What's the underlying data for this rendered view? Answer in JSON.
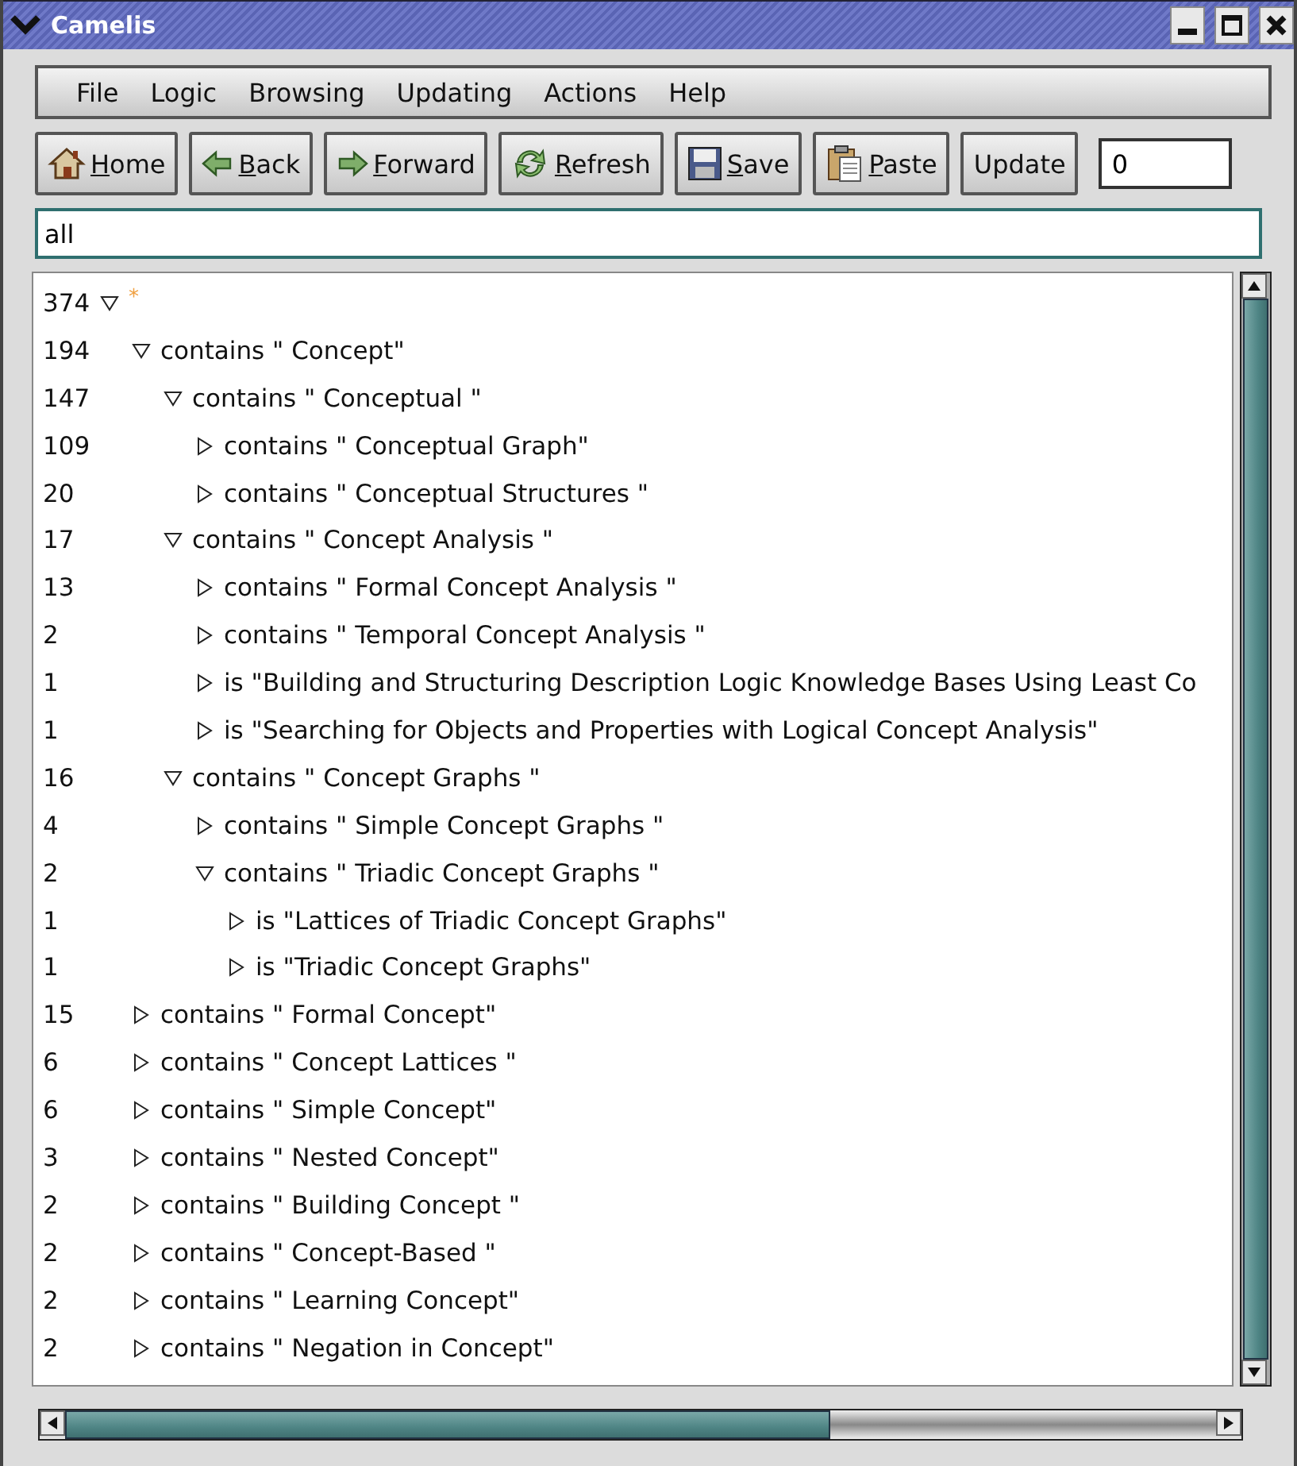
{
  "window": {
    "title": "Camelis"
  },
  "menu": [
    "File",
    "Logic",
    "Browsing",
    "Updating",
    "Actions",
    "Help"
  ],
  "toolbar": [
    {
      "label": "Home",
      "mnemonic": true
    },
    {
      "label": "Back",
      "mnemonic": true
    },
    {
      "label": "Forward",
      "mnemonic": true
    },
    {
      "label": "Refresh",
      "mnemonic": true
    },
    {
      "label": "Save",
      "mnemonic": true
    },
    {
      "label": "Paste",
      "mnemonic": true
    },
    {
      "label": "Update",
      "mnemonic": false
    }
  ],
  "counter_field": {
    "value": "0"
  },
  "query_field": {
    "value": "all"
  },
  "tree": [
    {
      "count": "374",
      "label": "*",
      "kind": "root",
      "expanded": true,
      "children": [
        {
          "count": "194",
          "label": "contains \" Concept\"",
          "expanded": true,
          "children": [
            {
              "count": "147",
              "label": "contains \" Conceptual \"",
              "expanded": true,
              "children": [
                {
                  "count": "109",
                  "label": "contains \" Conceptual Graph\"",
                  "expanded": false
                },
                {
                  "count": "20",
                  "label": "contains \" Conceptual Structures \"",
                  "expanded": false
                }
              ]
            },
            {
              "count": "17",
              "label": "contains \" Concept Analysis \"",
              "expanded": true,
              "children": [
                {
                  "count": "13",
                  "label": "contains \" Formal Concept Analysis \"",
                  "expanded": false
                },
                {
                  "count": "2",
                  "label": "contains \" Temporal Concept Analysis \"",
                  "expanded": false
                },
                {
                  "count": "1",
                  "label": "is \"Building and Structuring Description Logic Knowledge Bases Using Least Co",
                  "expanded": false
                },
                {
                  "count": "1",
                  "label": "is \"Searching for Objects and Properties with Logical Concept Analysis\"",
                  "expanded": false
                }
              ]
            },
            {
              "count": "16",
              "label": "contains \" Concept Graphs \"",
              "expanded": true,
              "children": [
                {
                  "count": "4",
                  "label": "contains \" Simple Concept Graphs \"",
                  "expanded": false
                },
                {
                  "count": "2",
                  "label": "contains \" Triadic Concept Graphs \"",
                  "expanded": true,
                  "children": [
                    {
                      "count": "1",
                      "label": "is \"Lattices of Triadic Concept Graphs\"",
                      "expanded": false
                    },
                    {
                      "count": "1",
                      "label": "is \"Triadic Concept Graphs\"",
                      "expanded": false
                    }
                  ]
                }
              ]
            }
          ]
        },
        {
          "count": "15",
          "label": "contains \" Formal Concept\"",
          "expanded": false
        },
        {
          "count": "6",
          "label": "contains \" Concept Lattices \"",
          "expanded": false
        },
        {
          "count": "6",
          "label": "contains \" Simple Concept\"",
          "expanded": false
        },
        {
          "count": "3",
          "label": "contains \" Nested Concept\"",
          "expanded": false
        },
        {
          "count": "2",
          "label": "contains \" Building Concept \"",
          "expanded": false
        },
        {
          "count": "2",
          "label": "contains \" Concept-Based \"",
          "expanded": false
        },
        {
          "count": "2",
          "label": "contains \" Learning Concept\"",
          "expanded": false
        },
        {
          "count": "2",
          "label": "contains \" Negation in Concept\"",
          "expanded": false
        }
      ]
    }
  ]
}
